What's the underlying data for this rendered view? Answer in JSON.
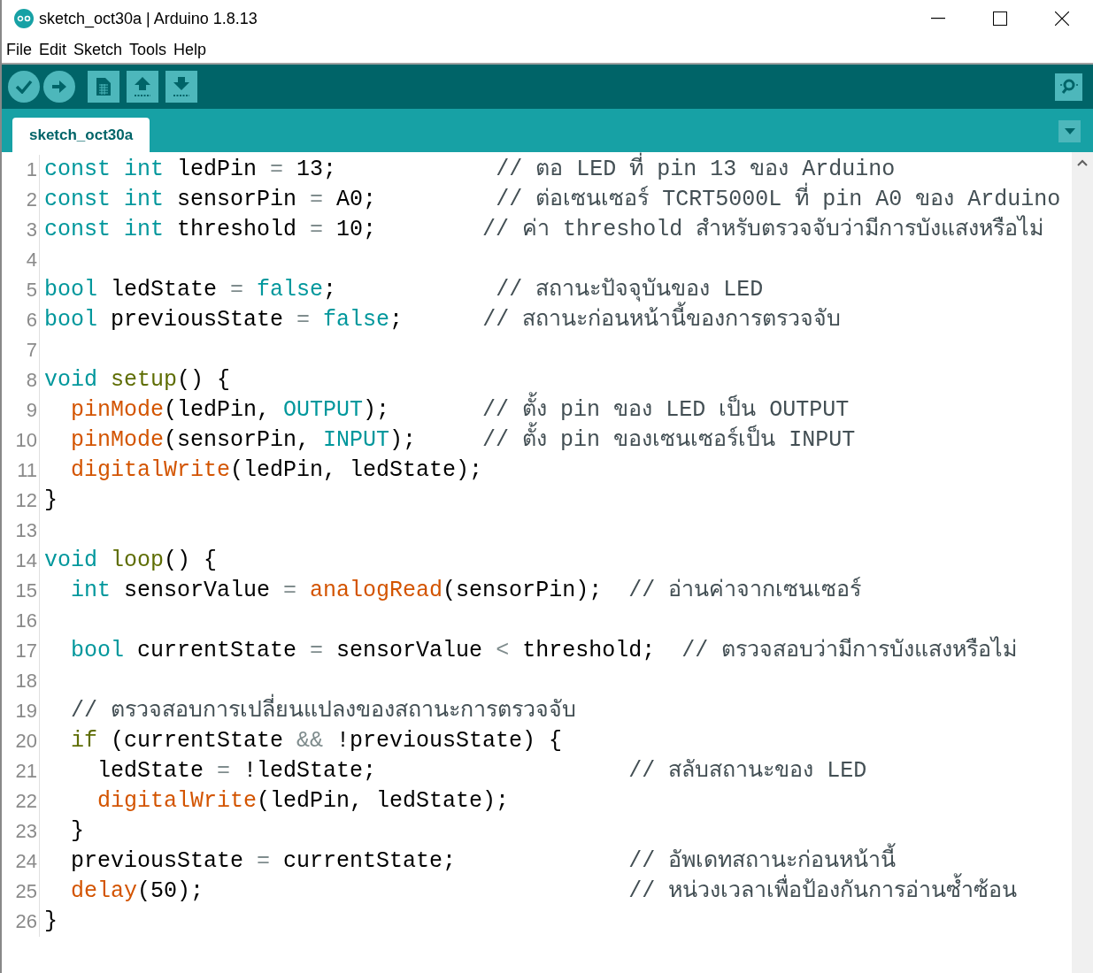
{
  "window": {
    "title": "sketch_oct30a | Arduino 1.8.13"
  },
  "menu": [
    "File",
    "Edit",
    "Sketch",
    "Tools",
    "Help"
  ],
  "tabs": [
    {
      "label": "sketch_oct30a",
      "selected": true
    }
  ],
  "lines": [
    {
      "number": "1",
      "tokens": [
        {
          "kind": "type",
          "text": "const"
        },
        {
          "kind": "type",
          "text": " int"
        },
        {
          "kind": "plain",
          "text": " ledPin "
        },
        {
          "kind": "op",
          "text": "="
        },
        {
          "kind": "plain",
          "text": " 13;            "
        },
        {
          "kind": "comment",
          "text": "// ตอ LED ที่ pin 13 ของ Arduino"
        }
      ]
    },
    {
      "number": "2",
      "tokens": [
        {
          "kind": "type",
          "text": "const"
        },
        {
          "kind": "type",
          "text": " int"
        },
        {
          "kind": "plain",
          "text": " sensorPin "
        },
        {
          "kind": "op",
          "text": "="
        },
        {
          "kind": "plain",
          "text": " A0;         "
        },
        {
          "kind": "comment",
          "text": "// ต่อเซนเซอร์ TCRT5000L ที่ pin A0 ของ Arduino"
        }
      ]
    },
    {
      "number": "3",
      "tokens": [
        {
          "kind": "type",
          "text": "const"
        },
        {
          "kind": "type",
          "text": " int"
        },
        {
          "kind": "plain",
          "text": " threshold "
        },
        {
          "kind": "op",
          "text": "="
        },
        {
          "kind": "plain",
          "text": " 10;        "
        },
        {
          "kind": "comment",
          "text": "// ค่า threshold สำหรับตรวจจับว่ามีการบังแสงหรือไม่"
        }
      ]
    },
    {
      "number": "4"
    },
    {
      "number": "5",
      "tokens": [
        {
          "kind": "type",
          "text": "bool"
        },
        {
          "kind": "plain",
          "text": " ledState "
        },
        {
          "kind": "op",
          "text": "="
        },
        {
          "kind": "type",
          "text": " false"
        },
        {
          "kind": "plain",
          "text": ";            "
        },
        {
          "kind": "comment",
          "text": "// สถานะปัจจุบันของ LED"
        }
      ]
    },
    {
      "number": "6",
      "tokens": [
        {
          "kind": "type",
          "text": "bool"
        },
        {
          "kind": "plain",
          "text": " previousState "
        },
        {
          "kind": "op",
          "text": "="
        },
        {
          "kind": "type",
          "text": " false"
        },
        {
          "kind": "plain",
          "text": ";      "
        },
        {
          "kind": "comment",
          "text": "// สถานะก่อนหน้านี้ของการตรวจจับ"
        }
      ]
    },
    {
      "number": "7"
    },
    {
      "number": "8",
      "tokens": [
        {
          "kind": "type",
          "text": "void"
        },
        {
          "kind": "struct",
          "text": " setup"
        },
        {
          "kind": "plain",
          "text": "() {"
        }
      ]
    },
    {
      "number": "9",
      "tokens": [
        {
          "kind": "func",
          "text": "  pinMode"
        },
        {
          "kind": "plain",
          "text": "(ledPin, "
        },
        {
          "kind": "type",
          "text": "OUTPUT"
        },
        {
          "kind": "plain",
          "text": ");       "
        },
        {
          "kind": "comment",
          "text": "// ตั้ง pin ของ LED เป็น OUTPUT"
        }
      ]
    },
    {
      "number": "10",
      "tokens": [
        {
          "kind": "func",
          "text": "  pinMode"
        },
        {
          "kind": "plain",
          "text": "(sensorPin, "
        },
        {
          "kind": "type",
          "text": "INPUT"
        },
        {
          "kind": "plain",
          "text": ");     "
        },
        {
          "kind": "comment",
          "text": "// ตั้ง pin ของเซนเซอร์เป็น INPUT"
        }
      ]
    },
    {
      "number": "11",
      "tokens": [
        {
          "kind": "func",
          "text": "  digitalWrite"
        },
        {
          "kind": "plain",
          "text": "(ledPin, ledState);"
        }
      ]
    },
    {
      "number": "12",
      "tokens": [
        {
          "kind": "plain",
          "text": "}"
        }
      ]
    },
    {
      "number": "13"
    },
    {
      "number": "14",
      "tokens": [
        {
          "kind": "type",
          "text": "void"
        },
        {
          "kind": "struct",
          "text": " loop"
        },
        {
          "kind": "plain",
          "text": "() {"
        }
      ]
    },
    {
      "number": "15",
      "tokens": [
        {
          "kind": "type",
          "text": "  int"
        },
        {
          "kind": "plain",
          "text": " sensorValue "
        },
        {
          "kind": "op",
          "text": "="
        },
        {
          "kind": "func",
          "text": " analogRead"
        },
        {
          "kind": "plain",
          "text": "(sensorPin);  "
        },
        {
          "kind": "comment",
          "text": "// อ่านค่าจากเซนเซอร์"
        }
      ]
    },
    {
      "number": "16"
    },
    {
      "number": "17",
      "tokens": [
        {
          "kind": "type",
          "text": "  bool"
        },
        {
          "kind": "plain",
          "text": " currentState "
        },
        {
          "kind": "op",
          "text": "="
        },
        {
          "kind": "plain",
          "text": " sensorValue "
        },
        {
          "kind": "op",
          "text": "<"
        },
        {
          "kind": "plain",
          "text": " threshold;  "
        },
        {
          "kind": "comment",
          "text": "// ตรวจสอบว่ามีการบังแสงหรือไม่"
        }
      ]
    },
    {
      "number": "18"
    },
    {
      "number": "19",
      "tokens": [
        {
          "kind": "comment",
          "text": "  // ตรวจสอบการเปลี่ยนแปลงของสถานะการตรวจจับ"
        }
      ]
    },
    {
      "number": "20",
      "tokens": [
        {
          "kind": "struct",
          "text": "  if"
        },
        {
          "kind": "plain",
          "text": " (currentState "
        },
        {
          "kind": "op",
          "text": "&&"
        },
        {
          "kind": "plain",
          "text": " !previousState) {"
        }
      ]
    },
    {
      "number": "21",
      "tokens": [
        {
          "kind": "plain",
          "text": "    ledState "
        },
        {
          "kind": "op",
          "text": "="
        },
        {
          "kind": "plain",
          "text": " !ledState;                   "
        },
        {
          "kind": "comment",
          "text": "// สลับสถานะของ LED"
        }
      ]
    },
    {
      "number": "22",
      "tokens": [
        {
          "kind": "func",
          "text": "    digitalWrite"
        },
        {
          "kind": "plain",
          "text": "(ledPin, ledState);"
        }
      ]
    },
    {
      "number": "23",
      "tokens": [
        {
          "kind": "plain",
          "text": "  }"
        }
      ]
    },
    {
      "number": "24",
      "tokens": [
        {
          "kind": "plain",
          "text": "  previousState "
        },
        {
          "kind": "op",
          "text": "="
        },
        {
          "kind": "plain",
          "text": " currentState;             "
        },
        {
          "kind": "comment",
          "text": "// อัพเดทสถานะก่อนหน้านี้"
        }
      ]
    },
    {
      "number": "25",
      "tokens": [
        {
          "kind": "func",
          "text": "  delay"
        },
        {
          "kind": "plain",
          "text": "(50);                                "
        },
        {
          "kind": "comment",
          "text": "// หน่วงเวลาเพื่อป้องกันการอ่านซ้ำซ้อน"
        }
      ]
    },
    {
      "number": "26",
      "tokens": [
        {
          "kind": "plain",
          "text": "}"
        }
      ]
    }
  ]
}
